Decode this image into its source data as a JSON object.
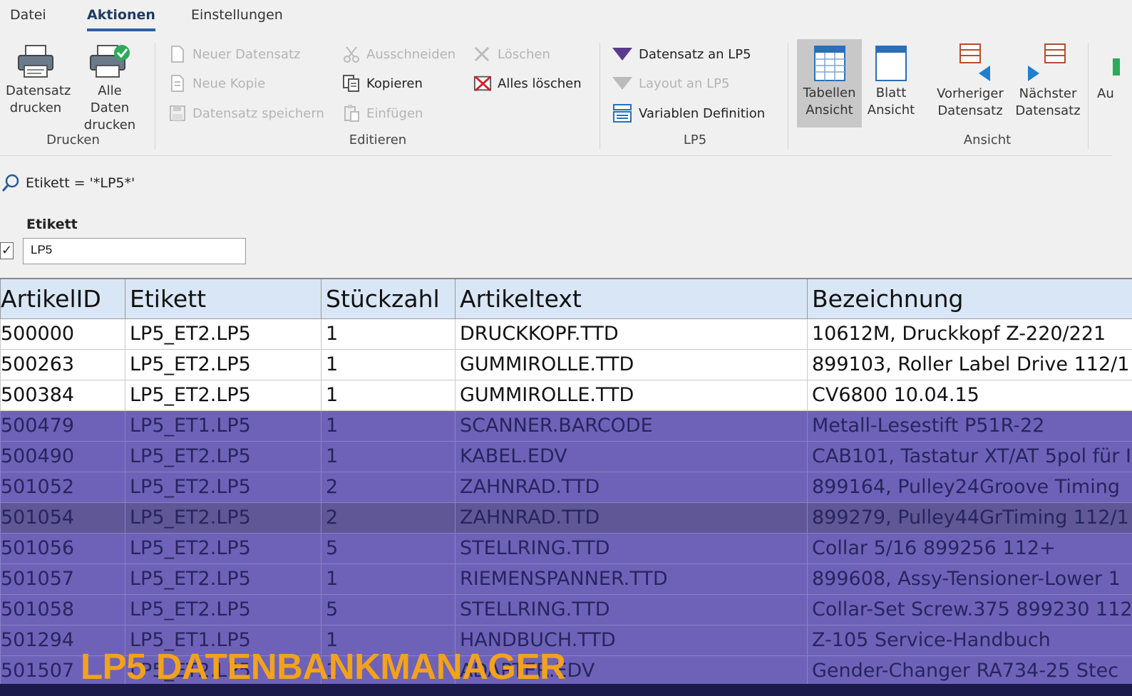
{
  "menu": {
    "tabs": [
      "Datei",
      "Aktionen",
      "Einstellungen"
    ],
    "active": "Aktionen"
  },
  "ribbon": {
    "drucken": {
      "label": "Drucken",
      "print_record": "Datensatz drucken",
      "print_all": "Alle Daten drucken"
    },
    "editieren": {
      "label": "Editieren",
      "new_record": "Neuer Datensatz",
      "new_copy": "Neue Kopie",
      "save_record": "Datensatz speichern",
      "cut": "Ausschneiden",
      "copy": "Kopieren",
      "paste": "Einfügen",
      "delete": "Löschen",
      "delete_all": "Alles löschen"
    },
    "lp5": {
      "label": "LP5",
      "record_to_lp5": "Datensatz an LP5",
      "layout_to_lp5": "Layout an LP5",
      "variable_definition": "Variablen Definition"
    },
    "ansicht": {
      "label": "Ansicht",
      "table_view": "Tabellen Ansicht",
      "sheet_view": "Blatt Ansicht",
      "prev_record": "Vorheriger Datensatz",
      "next_record": "Nächster Datensatz",
      "cut_off": "Au"
    }
  },
  "filter": {
    "expression": "Etikett = '*LP5*'",
    "field_label": "Etikett",
    "field_value": "LP5",
    "checked": "✓"
  },
  "table": {
    "columns": [
      "ArtikelID",
      "Etikett",
      "Stückzahl",
      "Artikeltext",
      "Bezeichnung"
    ],
    "rows": [
      [
        "500000",
        "LP5_ET2.LP5",
        "1",
        "DRUCKKOPF.TTD",
        "10612M, Druckkopf Z-220/221"
      ],
      [
        "500263",
        "LP5_ET2.LP5",
        "1",
        "GUMMIROLLE.TTD",
        "899103, Roller Label Drive 112/1"
      ],
      [
        "500384",
        "LP5_ET2.LP5",
        "1",
        "GUMMIROLLE.TTD",
        "CV6800 10.04.15"
      ],
      [
        "500479",
        "LP5_ET1.LP5",
        "1",
        "SCANNER.BARCODE",
        "Metall-Lesestift  P51R-22"
      ],
      [
        "500490",
        "LP5_ET2.LP5",
        "1",
        "KABEL.EDV",
        "CAB101, Tastatur XT/AT 5pol für I"
      ],
      [
        "501052",
        "LP5_ET2.LP5",
        "2",
        "ZAHNRAD.TTD",
        "899164, Pulley24Groove Timing"
      ],
      [
        "501054",
        "LP5_ET2.LP5",
        "2",
        "ZAHNRAD.TTD",
        "899279, Pulley44GrTiming 112/1"
      ],
      [
        "501056",
        "LP5_ET2.LP5",
        "5",
        "STELLRING.TTD",
        "Collar 5/16 899256 112+"
      ],
      [
        "501057",
        "LP5_ET2.LP5",
        "1",
        "RIEMENSPANNER.TTD",
        "899608, Assy-Tensioner-Lower 1"
      ],
      [
        "501058",
        "LP5_ET2.LP5",
        "5",
        "STELLRING.TTD",
        "Collar-Set Screw.375 899230 112"
      ],
      [
        "501294",
        "LP5_ET1.LP5",
        "1",
        "HANDBUCH.TTD",
        "Z-105 Service-Handbuch"
      ],
      [
        "501507",
        "LP5_ET2.LP5",
        "1",
        "ADAPTER.EDV",
        "Gender-Changer  RA734-25 Stec"
      ]
    ]
  },
  "banner": "LP5 DATENBANKMANAGER",
  "colors": {
    "highlight": "#6e62b8",
    "selected": "#5f5796",
    "banner": "#f2a21c",
    "header": "#d9e6f5"
  }
}
